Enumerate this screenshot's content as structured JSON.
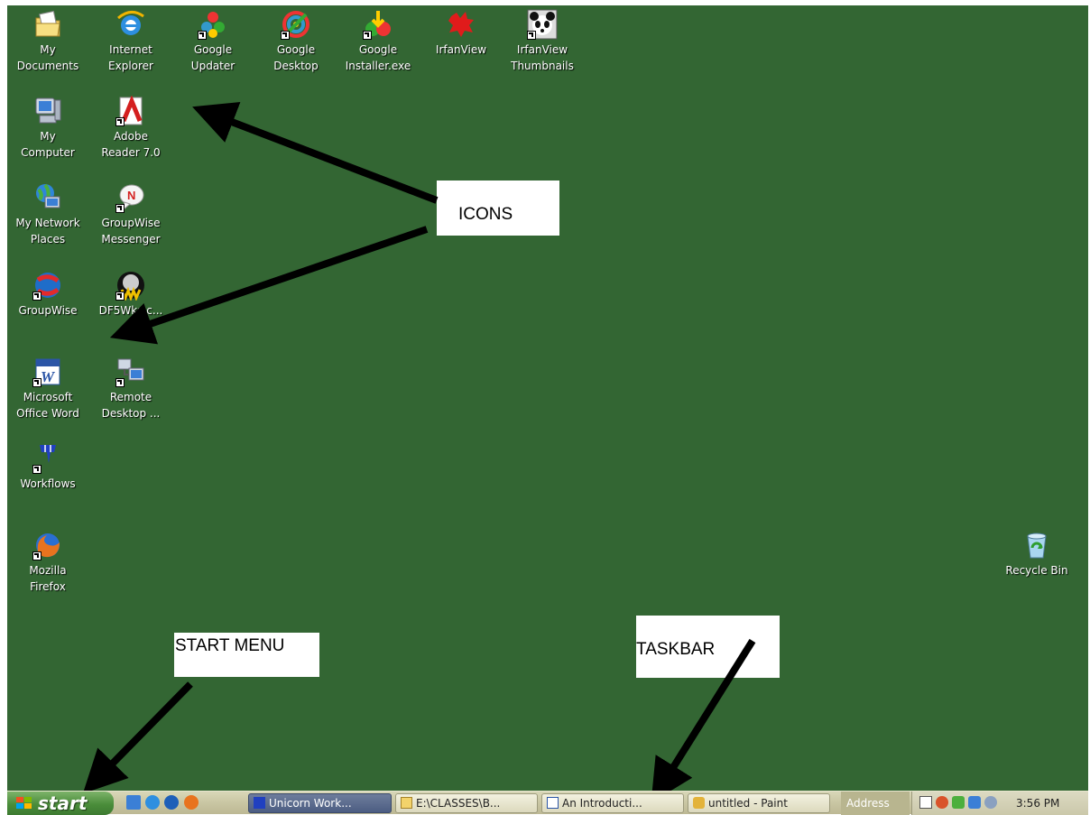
{
  "desktop": {
    "background": "#336633",
    "icons": [
      {
        "label": "My\nDocuments",
        "icon": "my-documents-icon"
      },
      {
        "label": "Internet\nExplorer",
        "icon": "internet-explorer-icon"
      },
      {
        "label": "Google\nUpdater",
        "icon": "google-updater-icon"
      },
      {
        "label": "Google\nDesktop",
        "icon": "google-desktop-icon"
      },
      {
        "label": "Google\nInstaller.exe",
        "icon": "google-installer-icon"
      },
      {
        "label": "IrfanView",
        "icon": "irfanview-icon"
      },
      {
        "label": "IrfanView\nThumbnails",
        "icon": "irfanview-thumbnails-icon"
      },
      {
        "label": "My\nComputer",
        "icon": "my-computer-icon"
      },
      {
        "label": "Adobe\nReader 7.0",
        "icon": "adobe-reader-icon"
      },
      {
        "label": "My Network\nPlaces",
        "icon": "my-network-places-icon"
      },
      {
        "label": "GroupWise\nMessenger",
        "icon": "groupwise-messenger-icon"
      },
      {
        "label": "GroupWise",
        "icon": "groupwise-icon"
      },
      {
        "label": "DF5Wks.c...",
        "icon": "df5wks-icon"
      },
      {
        "label": "Microsoft\nOffice Word",
        "icon": "microsoft-word-icon"
      },
      {
        "label": "Remote\nDesktop ...",
        "icon": "remote-desktop-icon"
      },
      {
        "label": "Workflows",
        "icon": "workflows-icon"
      },
      {
        "label": "Mozilla\nFirefox",
        "icon": "firefox-icon"
      },
      {
        "label": "Recycle Bin",
        "icon": "recycle-bin-icon"
      }
    ]
  },
  "callouts": {
    "icons": "ICONS",
    "start_menu": "START MENU",
    "taskbar": "TASKBAR"
  },
  "taskbar": {
    "start_label": "start",
    "quick_launch": [
      "show-desktop-icon",
      "internet-explorer-icon",
      "media-player-icon",
      "firefox-icon"
    ],
    "tasks": [
      {
        "label": "Unicorn Work...",
        "icon": "workflows-icon",
        "active": true
      },
      {
        "label": "E:\\CLASSES\\B...",
        "icon": "folder-icon",
        "active": false
      },
      {
        "label": "An Introducti...",
        "icon": "word-doc-icon",
        "active": false
      },
      {
        "label": "untitled - Paint",
        "icon": "paint-icon",
        "active": false
      }
    ],
    "address_label": "Address",
    "tray_icons": [
      "help-icon",
      "back-arrow-icon",
      "network-icon",
      "messenger-icon",
      "speaker-icon"
    ],
    "clock": "3:56 PM"
  }
}
